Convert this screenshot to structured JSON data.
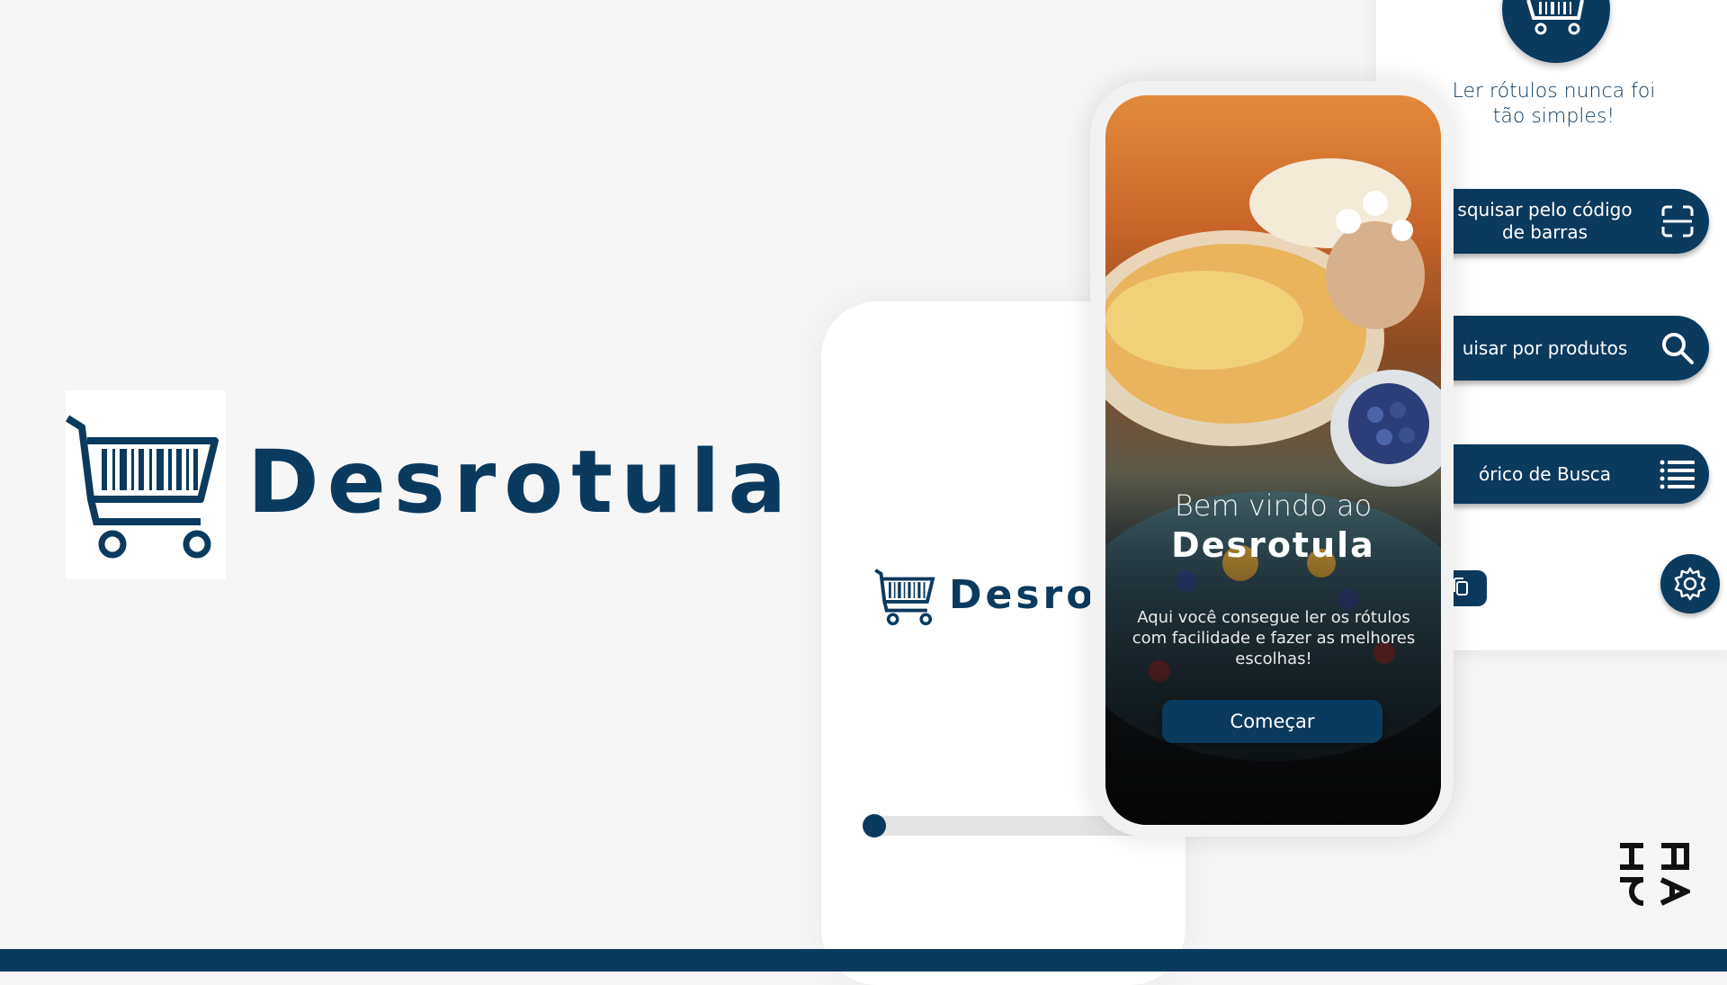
{
  "brand": {
    "name": "Desrotula",
    "splash_name": "Desrotu"
  },
  "colors": {
    "navy": "#0b3a5f",
    "background": "#f6f6f6",
    "white": "#ffffff"
  },
  "splash": {
    "progress": 0.05
  },
  "welcome": {
    "line1": "Bem vindo ao",
    "line2": "Desrotula",
    "description": "Aqui você consegue ler os rótulos com facilidade e fazer as melhores escolhas!",
    "start_button": "Começar"
  },
  "menu": {
    "tagline": "Ler rótulos nunca foi tão simples!",
    "buttons": [
      {
        "label": "squisar pelo código de barras",
        "icon": "barcode-scan-icon"
      },
      {
        "label": "uisar por produtos",
        "icon": "search-icon"
      },
      {
        "label": "órico de Busca",
        "icon": "list-icon"
      }
    ],
    "copy_icon": "copy-icon",
    "settings_icon": "gear-icon"
  },
  "corner_mark": {
    "icon": "studio-monogram-icon"
  }
}
